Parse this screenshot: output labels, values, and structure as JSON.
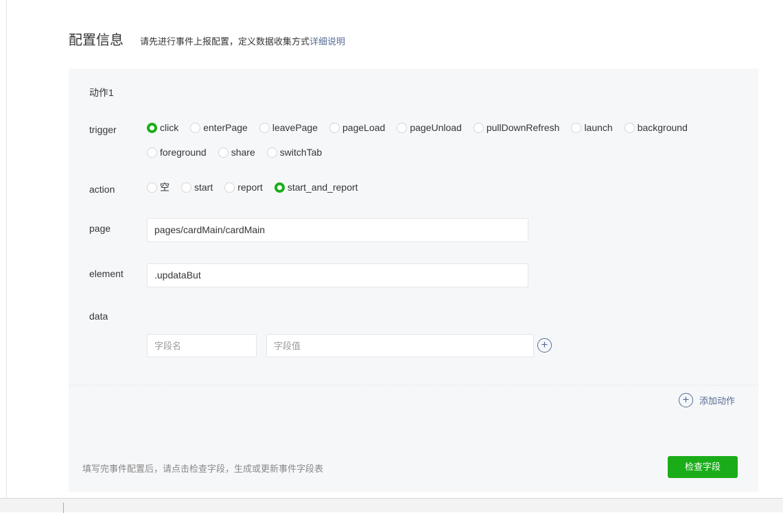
{
  "header": {
    "title": "配置信息",
    "desc": "请先进行事件上报配置，定义数据收集方式",
    "link": "详细说明"
  },
  "action": {
    "title": "动作1",
    "trigger": {
      "label": "trigger",
      "options": [
        "click",
        "enterPage",
        "leavePage",
        "pageLoad",
        "pageUnload",
        "pullDownRefresh",
        "launch",
        "background",
        "foreground",
        "share",
        "switchTab"
      ],
      "selected": "click"
    },
    "action": {
      "label": "action",
      "options": [
        "空",
        "start",
        "report",
        "start_and_report"
      ],
      "selected": "start_and_report"
    },
    "page": {
      "label": "page",
      "value": "pages/cardMain/cardMain"
    },
    "element": {
      "label": "element",
      "value": ".updataBut"
    },
    "data": {
      "label": "data",
      "key_placeholder": "字段名",
      "value_placeholder": "字段值"
    }
  },
  "add_action": "添加动作",
  "footer": {
    "hint": "填写完事件配置后，请点击检查字段，生成或更新事件字段表",
    "button": "检查字段"
  },
  "colors": {
    "accent": "#1aad19",
    "link": "#576b95"
  }
}
